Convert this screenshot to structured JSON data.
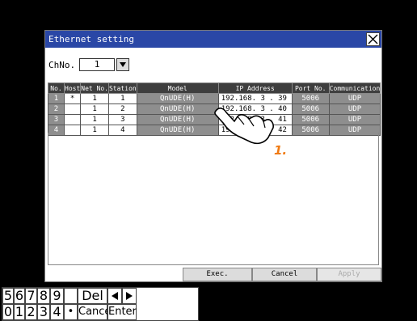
{
  "window": {
    "title": "Ethernet setting",
    "close_icon": "close-icon"
  },
  "channel": {
    "label": "ChNo.",
    "value": "1",
    "dropdown_icon": "triangle-down-icon"
  },
  "table": {
    "headers": [
      "No.",
      "Host",
      "Net No.",
      "Station",
      "Model",
      "IP Address",
      "Port No.",
      "Communication"
    ],
    "rows": [
      {
        "no": "1",
        "host": "*",
        "net": "1",
        "station": "1",
        "model": "QnUDE(H)",
        "ip": "192.168. 3 . 39",
        "port": "5006",
        "comm": "UDP"
      },
      {
        "no": "2",
        "host": "",
        "net": "1",
        "station": "2",
        "model": "QnUDE(H)",
        "ip": "192.168. 3 . 40",
        "port": "5006",
        "comm": "UDP"
      },
      {
        "no": "3",
        "host": "",
        "net": "1",
        "station": "3",
        "model": "QnUDE(H)",
        "ip": "192.168. 3 . 41",
        "port": "5006",
        "comm": "UDP"
      },
      {
        "no": "4",
        "host": "",
        "net": "1",
        "station": "4",
        "model": "QnUDE(H)",
        "ip": "192.168. 3 . 42",
        "port": "5006",
        "comm": "UDP"
      }
    ]
  },
  "buttons": {
    "exec": "Exec.",
    "cancel": "Cancel",
    "apply": "Apply"
  },
  "keypad": {
    "row1": [
      "5",
      "6",
      "7",
      "8",
      "9",
      "",
      "Del"
    ],
    "row2": [
      "0",
      "1",
      "2",
      "3",
      "4",
      "•",
      "Cancel",
      "Enter"
    ],
    "left_icon": "arrow-left-icon",
    "right_icon": "arrow-right-icon"
  },
  "annotation": {
    "step": "1.",
    "color": "#f07a12"
  },
  "colors": {
    "title_bar": "#2a47a6",
    "header": "#3e3e3e",
    "row_fill": "#8e8e8e"
  }
}
